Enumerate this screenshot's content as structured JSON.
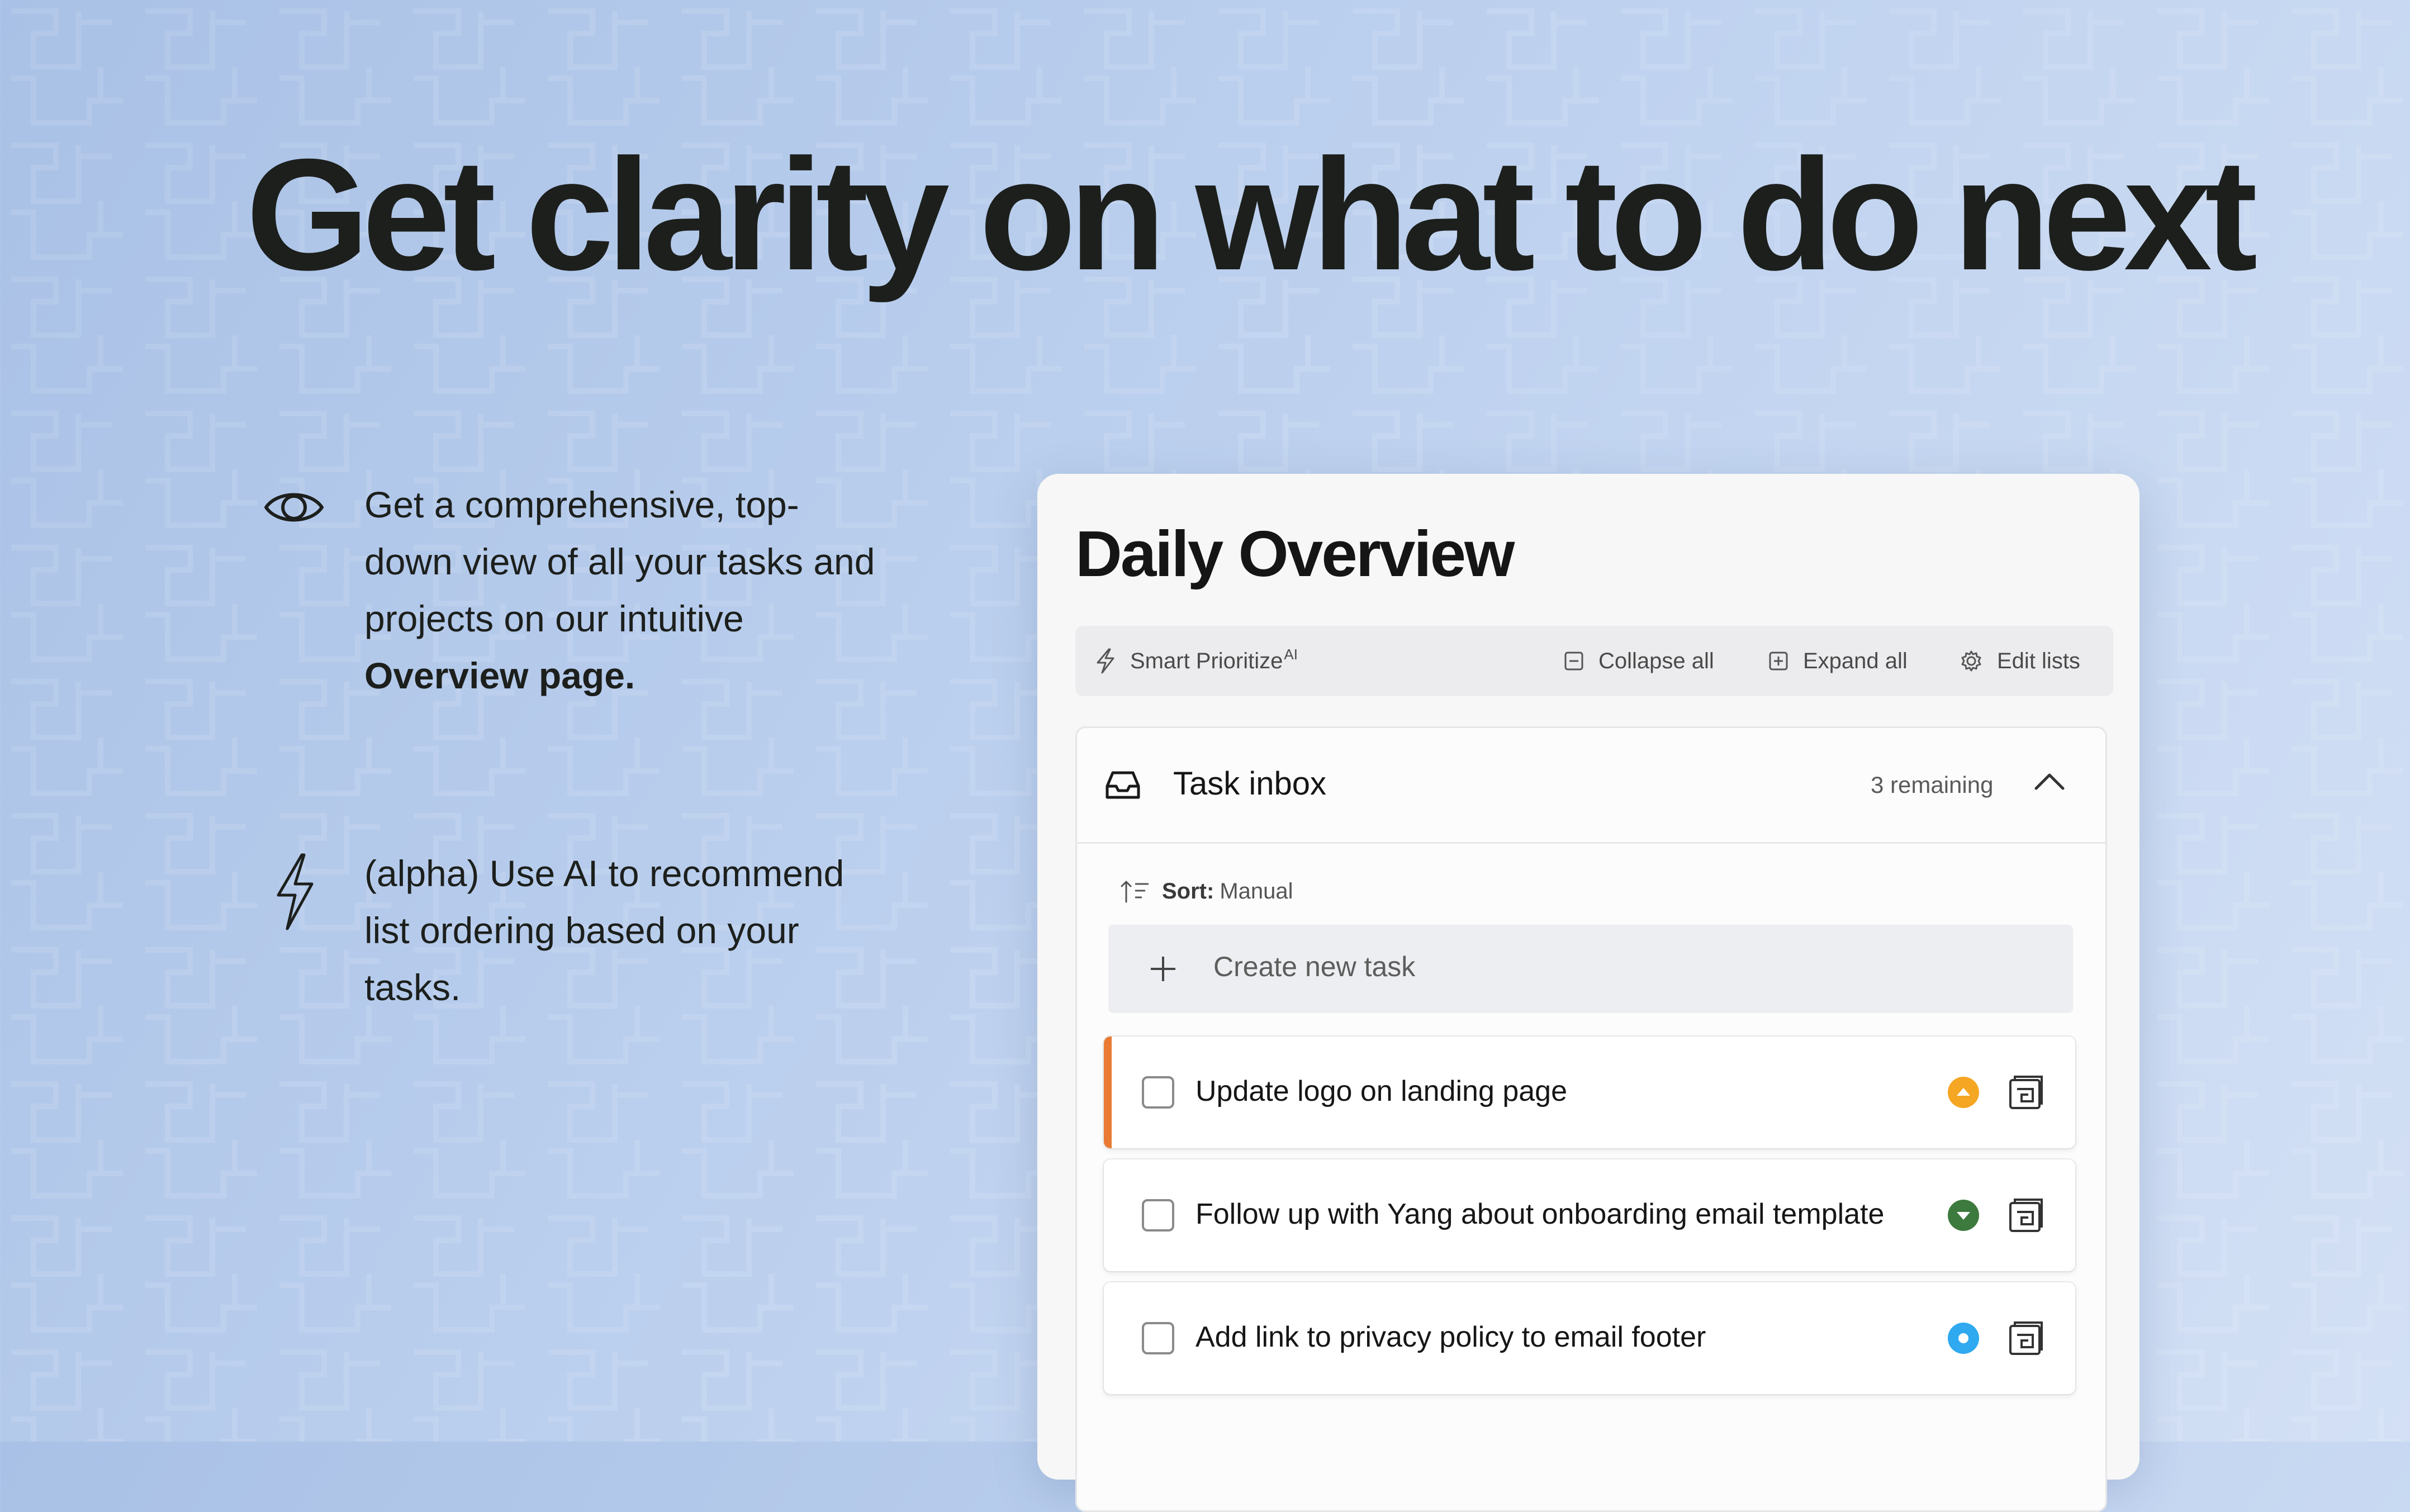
{
  "hero": {
    "headline": "Get clarity on what to do next"
  },
  "features": [
    {
      "icon": "eye-icon",
      "text_before": "Get a comprehensive, top-down view of all your tasks and projects on our intuitive ",
      "text_bold": "Overview page."
    },
    {
      "icon": "lightning-icon",
      "text": "(alpha) Use AI to recommend list ordering based on your tasks."
    }
  ],
  "overview": {
    "title": "Daily Overview",
    "toolbar": {
      "smart_prioritize": "Smart Prioritize",
      "smart_prioritize_badge": "AI",
      "collapse_all": "Collapse all",
      "expand_all": "Expand all",
      "edit_lists": "Edit lists"
    },
    "list": {
      "title": "Task inbox",
      "remaining": "3 remaining",
      "sort_label": "Sort:",
      "sort_value": "Manual",
      "create_placeholder": "Create new task",
      "tasks": [
        {
          "title": "Update logo on landing page",
          "priority": "high",
          "priority_color": "#f5a623",
          "accent_color": "#ea7a33"
        },
        {
          "title": "Follow up with Yang about onboarding email template",
          "priority": "low",
          "priority_color": "#3d7a3d"
        },
        {
          "title": "Add link to privacy policy to email footer",
          "priority": "medium",
          "priority_color": "#2fa9f0"
        }
      ]
    }
  },
  "colors": {
    "background_start": "#a9c1e6",
    "background_end": "#d3e0f5",
    "accent_orange": "#ea7a33"
  }
}
